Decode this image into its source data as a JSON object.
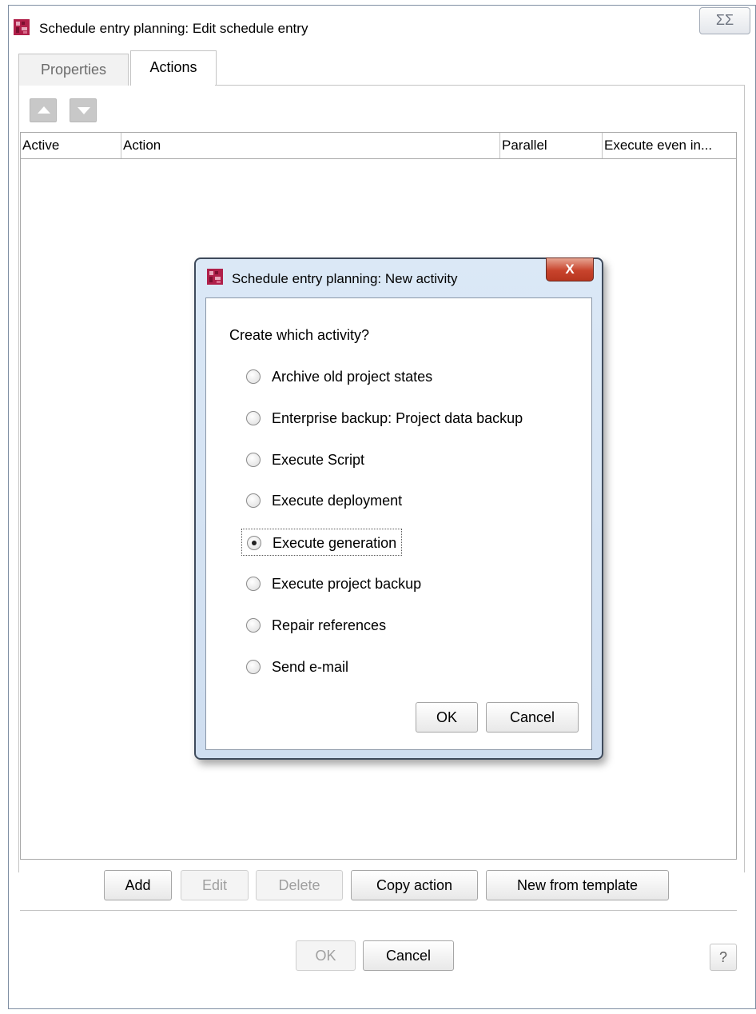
{
  "window": {
    "title": "Schedule entry planning:  Edit schedule entry",
    "close_glyph": "ΣΣ"
  },
  "tabs": [
    {
      "label": "Properties",
      "active": false
    },
    {
      "label": "Actions",
      "active": true
    }
  ],
  "toolbar": {
    "move_up_icon": "triangle-up",
    "move_down_icon": "triangle-down"
  },
  "table": {
    "columns": [
      "Active",
      "Action",
      "Parallel",
      "Execute even in..."
    ],
    "rows": []
  },
  "action_buttons": {
    "add": "Add",
    "edit": "Edit",
    "delete": "Delete",
    "copy_action": "Copy action",
    "new_from_template": "New from template"
  },
  "footer": {
    "ok": "OK",
    "cancel": "Cancel",
    "help": "?"
  },
  "dialog": {
    "title": "Schedule entry planning: New activity",
    "close_glyph": "X",
    "prompt": "Create which activity?",
    "options": [
      {
        "label": "Archive old project states",
        "selected": false
      },
      {
        "label": "Enterprise backup: Project data backup",
        "selected": false
      },
      {
        "label": "Execute Script",
        "selected": false
      },
      {
        "label": "Execute deployment",
        "selected": false
      },
      {
        "label": "Execute generation",
        "selected": true
      },
      {
        "label": "Execute project backup",
        "selected": false
      },
      {
        "label": "Repair references",
        "selected": false
      },
      {
        "label": "Send e-mail",
        "selected": false
      }
    ],
    "ok": "OK",
    "cancel": "Cancel"
  },
  "colors": {
    "brand_icon": "#b0204a",
    "dialog_frame": "#cfdef0",
    "close_red": "#c8432c"
  }
}
